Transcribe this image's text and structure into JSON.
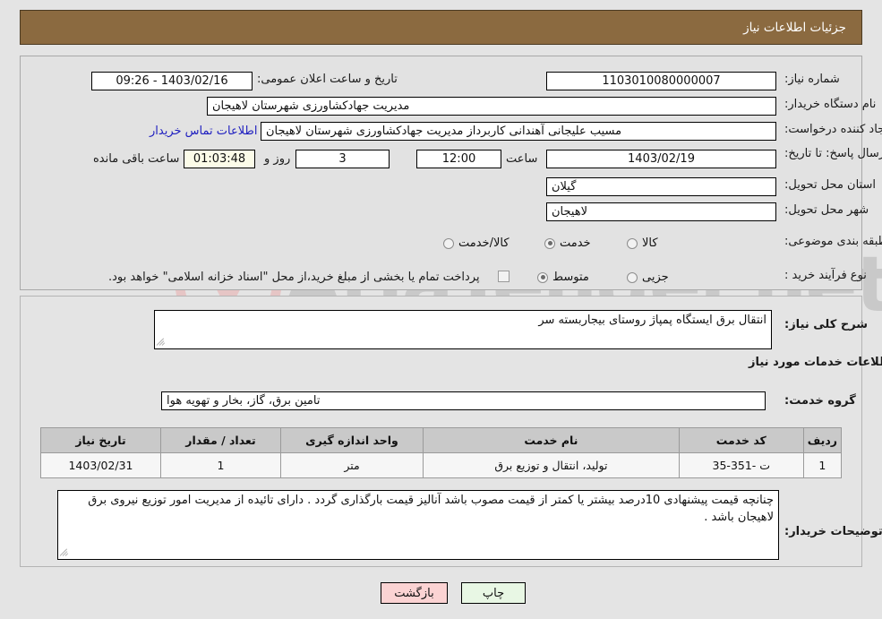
{
  "header": {
    "title": "جزئیات اطلاعات نیاز"
  },
  "watermark": {
    "text": "AriaTender.net",
    "shield_color": "#e8c4c4",
    "text_color": "#8c8c8c"
  },
  "form": {
    "need_number": {
      "label": "شماره نیاز:",
      "value": "1103010080000007"
    },
    "public_announce": {
      "label": "تاریخ و ساعت اعلان عمومی:",
      "value": "1403/02/16 - 09:26"
    },
    "buyer_org": {
      "label": "نام دستگاه خریدار:",
      "value": "مدیریت جهادکشاورزی شهرستان لاهیجان"
    },
    "request_creator": {
      "label": "ایجاد کننده درخواست:",
      "value": "مسیب علیجانی آهندانی کاربرداز مدیریت جهادکشاورزی شهرستان لاهیجان"
    },
    "buyer_contact_link": "اطلاعات تماس خریدار",
    "deadline": {
      "label": "مهلت ارسال پاسخ: تا تاریخ:",
      "date": "1403/02/19",
      "time_label": "ساعت",
      "time": "12:00",
      "days": "3",
      "days_label": "روز و",
      "countdown": "01:03:48",
      "countdown_label": "ساعت باقی مانده"
    },
    "province": {
      "label": "استان محل تحویل:",
      "value": "گیلان"
    },
    "city": {
      "label": "شهر محل تحویل:",
      "value": "لاهیجان"
    },
    "category": {
      "label": "طبقه بندی موضوعی:",
      "options": [
        "کالا",
        "خدمت",
        "کالا/خدمت"
      ],
      "selected": "خدمت"
    },
    "process_type": {
      "label": "نوع فرآیند خرید :",
      "options": [
        "جزیی",
        "متوسط"
      ],
      "selected": "متوسط"
    },
    "treasury_note": {
      "text": "پرداخت تمام یا بخشی از مبلغ خرید،از محل \"اسناد خزانه اسلامی\" خواهد بود.",
      "checked": false
    }
  },
  "details": {
    "general_desc": {
      "label": "شرح کلی نیاز:",
      "value": "انتقال برق ایستگاه پمپاژ روستای بیجاربسته سر"
    },
    "services_heading": "اطلاعات خدمات مورد نیاز",
    "service_group": {
      "label": "گروه خدمت:",
      "value": "تامین برق، گاز، بخار و تهویه هوا"
    },
    "buyer_remarks": {
      "label": "توضیحات خریدار:",
      "value": "چنانچه قیمت پیشنهادی 10درصد بیشتر یا کمتر از قیمت مصوب باشد  آنالیز قیمت بارگذاری گردد . دارای تائیده از مدیریت امور توزیع نیروی برق لاهیجان باشد ."
    }
  },
  "table": {
    "headers": [
      "ردیف",
      "کد خدمت",
      "نام خدمت",
      "واحد اندازه گیری",
      "تعداد / مقدار",
      "تاریخ نیاز"
    ],
    "rows": [
      {
        "radif": "1",
        "code": "ت -351-35",
        "name": "تولید، انتقال و توزیع برق",
        "unit": "متر",
        "qty": "1",
        "date": "1403/02/31"
      }
    ]
  },
  "footer": {
    "back_label": "بازگشت",
    "print_label": "چاپ"
  }
}
